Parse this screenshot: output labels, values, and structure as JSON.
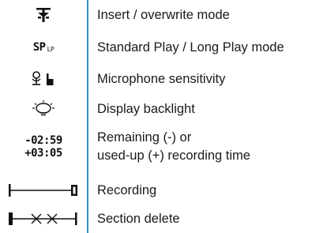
{
  "rows": [
    {
      "icon": "insert-overwrite-icon",
      "description": "Insert / overwrite mode"
    },
    {
      "icon": "sp-lp-icon",
      "icon_text": "SP",
      "icon_subtext": "LP",
      "description": "Standard Play / Long Play mode"
    },
    {
      "icon": "microphone-sensitivity-icon",
      "description": "Microphone sensitivity"
    },
    {
      "icon": "backlight-icon",
      "description": "Display backlight"
    },
    {
      "icon": "time-display-icon",
      "icon_text_1": "-02:59",
      "icon_text_2": "+03:05",
      "description_line_1": "Remaining (-) or",
      "description_line_2": "used-up (+) recording time"
    },
    {
      "icon": "recording-bar-icon",
      "description": "Recording"
    },
    {
      "icon": "section-delete-icon",
      "description": "Section delete"
    }
  ],
  "colors": {
    "divider": "#2a8fc4",
    "text": "#1a1a1a"
  }
}
